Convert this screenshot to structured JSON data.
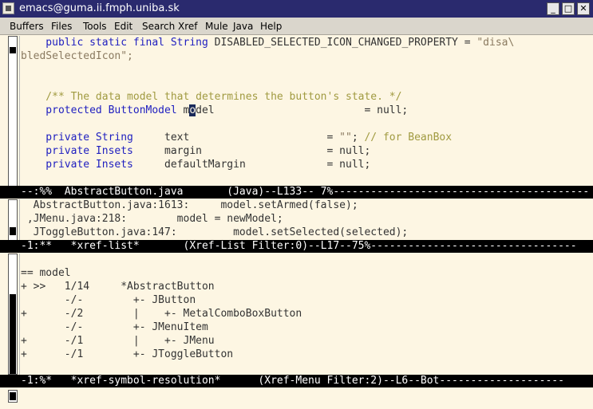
{
  "window": {
    "title": "emacs@guma.ii.fmph.uniba.sk",
    "minimize_label": "_",
    "maximize_label": "□",
    "close_label": "✕"
  },
  "menubar": [
    "Buffers",
    "Files",
    "Tools",
    "Edit",
    "Search",
    "Xref",
    "Mule",
    "Java",
    "Help"
  ],
  "code": {
    "l1a": "    public static final String DISABLED_SELECTED_ICON_CHANGED_PROPERTY = \"disa\\",
    "l1b": "bledSelectedIcon\";",
    "comment": "    /** The data model that determines the button's state. */",
    "model_kw": "    protected ButtonModel m",
    "model_cursor": "o",
    "model_rest": "del                        = null;",
    "text_line": "    private String     text                      = \"\"; // for BeanBox",
    "margin_line": "    private Insets     margin                    = null;",
    "defmargin_line": "    private Insets     defaultMargin             = null;"
  },
  "modeline1": "--:%%  AbstractButton.java       (Java)--L133-- 7%-----------------------------------------",
  "xref_list": [
    "  AbstractButton.java:1613:     model.setArmed(false);",
    " ,JMenu.java:218:        model = newModel;",
    "  JToggleButton.java:147:         model.setSelected(selected);"
  ],
  "modeline2": "-1:**   *xref-list*       (Xref-List Filter:0)--L17--75%---------------------------------",
  "symbol_res": [
    "== model",
    "+ >>   1/14     *AbstractButton",
    "       -/-        +- JButton",
    "+      -/2        |    +- MetalComboBoxButton",
    "       -/-        +- JMenuItem",
    "+      -/1        |    +- JMenu",
    "+      -/1        +- JToggleButton"
  ],
  "modeline3": "-1:%*   *xref-symbol-resolution*      (Xref-Menu Filter:2)--L6--Bot--------------------"
}
